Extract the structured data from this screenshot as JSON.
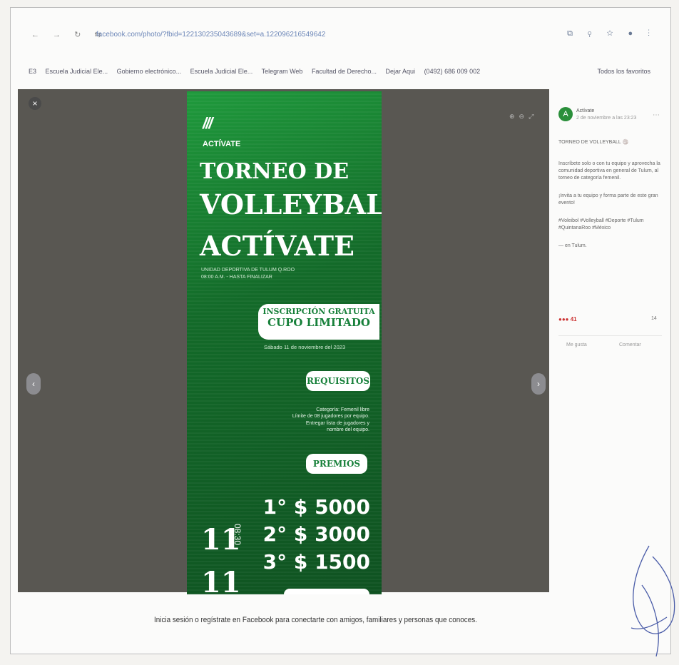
{
  "browser": {
    "url": "facebook.com/photo/?fbid=122130235043689&set=a.122096216549642",
    "bookmarks": [
      "E3",
      "Escuela Judicial Ele...",
      "Gobierno electrónico...",
      "Escuela Judicial Ele...",
      "Telegram Web",
      "Facultad de Derecho...",
      "Dejar Aqui",
      "(0492) 686 009 002"
    ],
    "all_bookmarks": "Todos los favoritos"
  },
  "poster": {
    "logo_text": "ACTÍVATE",
    "title_line1": "TORNEO DE",
    "title_line2": "VOLLEYBALL",
    "title_line3": "ACTÍVATE",
    "subtitle_line1": "UNIDAD DEPORTIVA DE TULUM Q.ROO",
    "subtitle_line2": "08:00 A.M. - HASTA FINALIZAR",
    "registration_line1": "INSCRIPCIÓN GRATUITA",
    "registration_line2": "CUPO LIMITADO",
    "date": "Sábado 11 de noviembre del 2023",
    "requirements_label": "REQUISITOS",
    "requirements_line1": "Categoría: Femenil libre",
    "requirements_line2": "Límite de 08 jugadores por equipo.",
    "requirements_line3": "Entregar lista de jugadores y",
    "requirements_line4": "nombre del equipo.",
    "prizes_label": "PREMIOS",
    "prize1": "1° $ 5000",
    "prize2": "2° $ 3000",
    "prize3": "3° $ 1500",
    "day": "11",
    "month": "11",
    "hour": "08:30"
  },
  "side_panel": {
    "author": "Actívate",
    "date": "2 de noviembre a las 23:23",
    "post_line1": "TORNEO DE VOLLEYBALL 🏐",
    "post_line2": "Inscríbete solo o con tu equipo y aprovecha la comunidad deportiva en general de Tulum, al torneo de categoría femenil.",
    "post_line3": "¡Invita a tu equipo y forma parte de este gran evento!",
    "post_tags": "#Voleibol #Volleyball #Deporte #Tulum #QuintanaRoo #México",
    "post_location": "— en Tulum.",
    "reactions": "41",
    "shares": "14",
    "like_label": "Me gusta",
    "comment_label": "Comentar"
  },
  "footer": {
    "login_prompt": "Inicia sesión o regístrate en Facebook para conectarte con amigos, familiares y personas que conoces."
  }
}
